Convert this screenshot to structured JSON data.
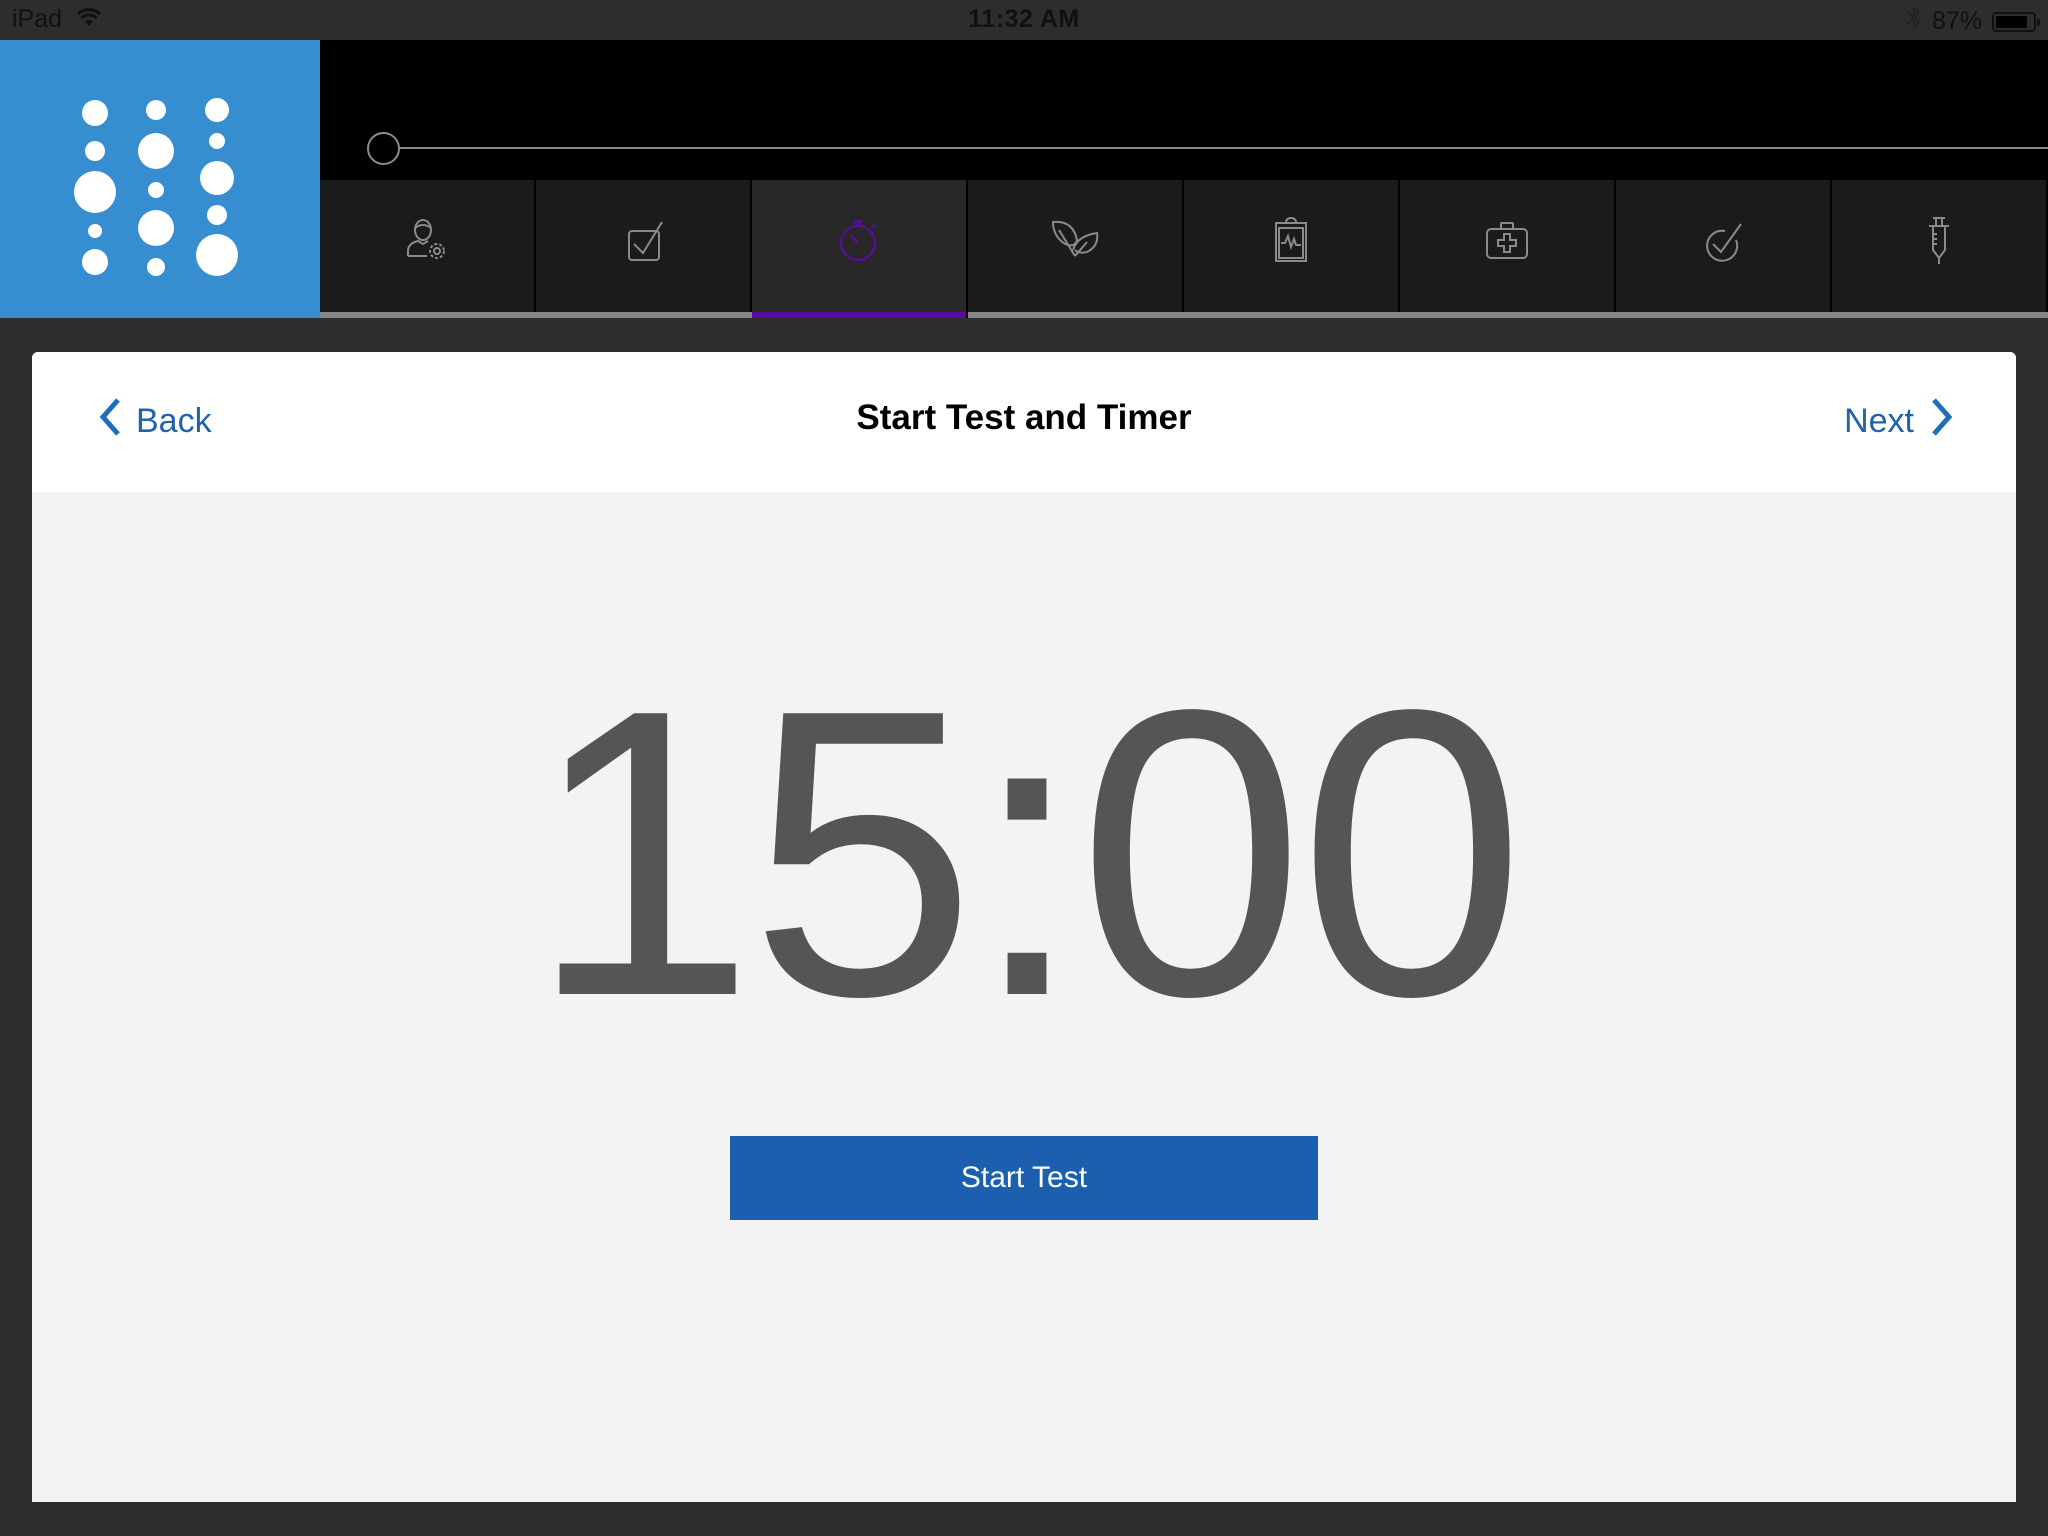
{
  "status_bar": {
    "device": "iPad",
    "time": "11:32 AM",
    "battery_percent_label": "87%",
    "battery_level": 0.87,
    "icons": [
      "wifi-icon",
      "bluetooth-icon",
      "battery-icon"
    ]
  },
  "logo": {
    "name": "app-logo-dots"
  },
  "progress": {
    "value": 0
  },
  "tabs": [
    {
      "id": "patient-settings",
      "icon": "user-gear-icon",
      "active": false
    },
    {
      "id": "checklist",
      "icon": "checkbox-icon",
      "active": false
    },
    {
      "id": "timer",
      "icon": "stopwatch-icon",
      "active": true
    },
    {
      "id": "allergens",
      "icon": "leaves-icon",
      "active": false
    },
    {
      "id": "clipboard-vitals",
      "icon": "clipboard-pulse-icon",
      "active": false
    },
    {
      "id": "medical-kit",
      "icon": "medical-kit-icon",
      "active": false
    },
    {
      "id": "confirm",
      "icon": "check-circle-icon",
      "active": false
    },
    {
      "id": "injection",
      "icon": "syringe-icon",
      "active": false
    }
  ],
  "colors": {
    "brand_blue": "#368dd0",
    "link_blue": "#1f63ad",
    "button_blue": "#1b5fae",
    "active_tab_accent": "#5b0ba0",
    "icon_grey": "#8a8a8a",
    "timer_text": "#555555"
  },
  "header": {
    "back_label": "Back",
    "title": "Start Test and Timer",
    "next_label": "Next"
  },
  "timer": {
    "display": "15:00"
  },
  "actions": {
    "start_label": "Start Test"
  }
}
